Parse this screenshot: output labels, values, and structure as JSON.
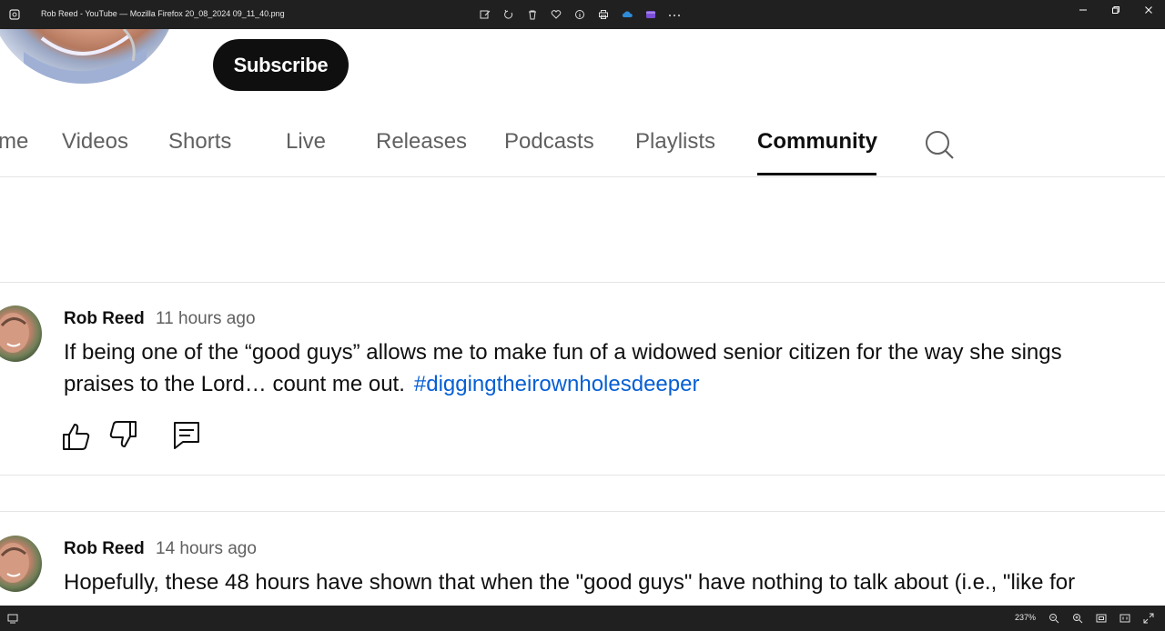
{
  "viewer": {
    "title": "Rob Reed - YouTube — Mozilla Firefox 20_08_2024 09_11_40.png",
    "zoom": "237%"
  },
  "channel": {
    "subscribe_label": "Subscribe"
  },
  "tabs": [
    {
      "label": "me"
    },
    {
      "label": "Videos"
    },
    {
      "label": "Shorts"
    },
    {
      "label": "Live"
    },
    {
      "label": "Releases"
    },
    {
      "label": "Podcasts"
    },
    {
      "label": "Playlists"
    },
    {
      "label": "Community",
      "active": true
    }
  ],
  "posts": [
    {
      "author": "Rob Reed",
      "time": "11 hours ago",
      "text": "If being one of the “good guys” allows me to make fun of a widowed senior citizen for the way she sings praises to the Lord… count me out.",
      "hashtag": "#diggingtheirownholesdeeper"
    },
    {
      "author": "Rob Reed",
      "time": "14 hours ago",
      "text": "Hopefully, these 48 hours have shown that when the \"good guys\" have nothing to talk about (i.e., \"like for"
    }
  ],
  "colors": {
    "link": "#065fd4",
    "text_primary": "#0f0f0f",
    "text_secondary": "#606060",
    "viewer_chrome": "#202020"
  }
}
